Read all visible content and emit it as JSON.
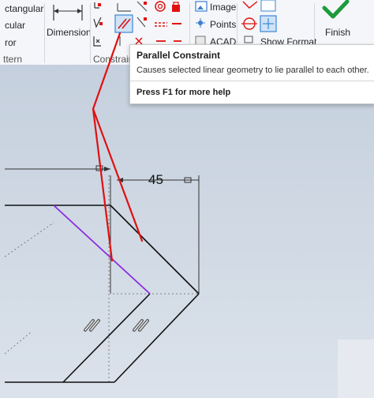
{
  "ribbon": {
    "left_panel": [
      "ctangular",
      "cular",
      "ror"
    ],
    "left_panel_label": "ttern",
    "dimension_label": "Dimension",
    "constraint_label": "Constrain",
    "insert_items": [
      "Image",
      "Points",
      "ACAD"
    ],
    "format_label": "Show Format",
    "finish_label": "Finish"
  },
  "tooltip": {
    "title": "Parallel Constraint",
    "description": "Causes selected linear geometry to lie parallel to each other.",
    "help": "Press F1 for more help"
  },
  "sketch": {
    "dimension_value": "45",
    "colors": {
      "sketch_line": "#000000",
      "selected_line": "#8a2be2",
      "annotation": "#e01010",
      "background": "#cdd6e2"
    }
  }
}
